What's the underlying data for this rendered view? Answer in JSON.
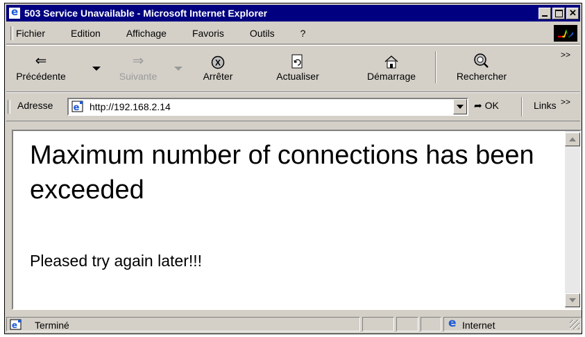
{
  "window": {
    "title": "503 Service Unavailable - Microsoft Internet Explorer"
  },
  "menu": {
    "items": [
      {
        "label": "Fichier"
      },
      {
        "label": "Edition"
      },
      {
        "label": "Affichage"
      },
      {
        "label": "Favoris"
      },
      {
        "label": "Outils"
      },
      {
        "label": "?"
      }
    ]
  },
  "toolbar": {
    "back": "Précédente",
    "forward": "Suivante",
    "stop": "Arrêter",
    "refresh": "Actualiser",
    "home": "Démarrage",
    "search": "Rechercher",
    "more": ">>"
  },
  "address": {
    "label": "Adresse",
    "url": "http://192.168.2.14",
    "go": "OK",
    "links": "Links",
    "more": ">>"
  },
  "page": {
    "heading": "Maximum number of connections has been exceeded",
    "message": "Pleased try again later!!!"
  },
  "status": {
    "text": "Terminé",
    "zone": "Internet"
  }
}
